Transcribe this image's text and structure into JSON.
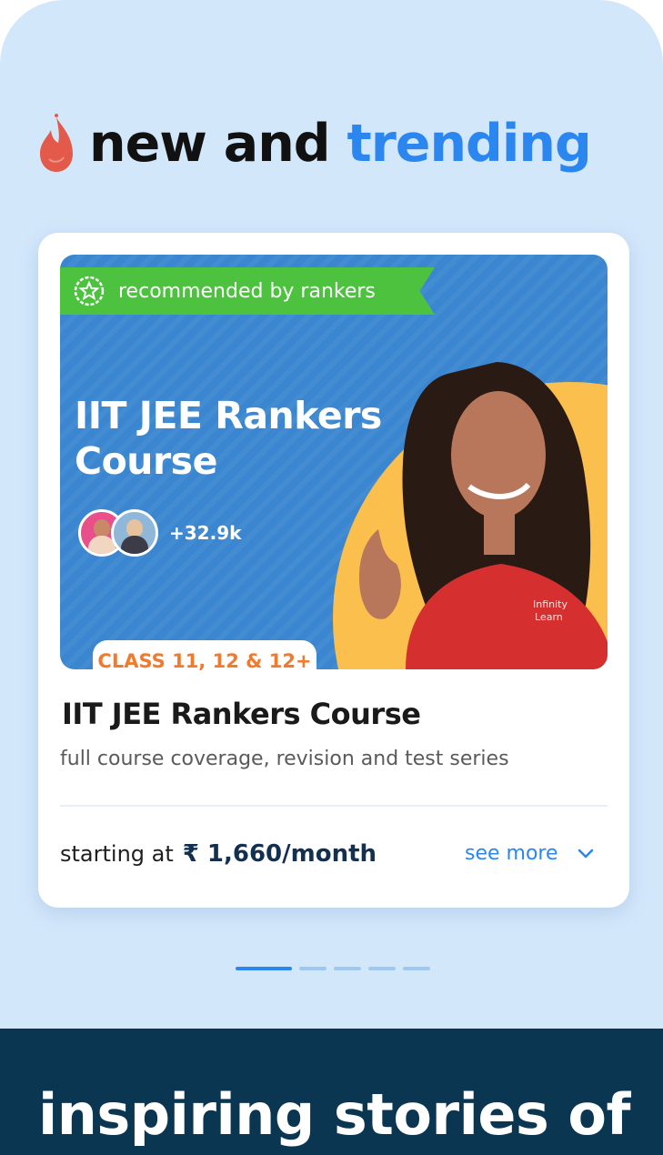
{
  "section": {
    "title_part1": "new and",
    "title_part2": "trending",
    "flame_icon": "flame-icon"
  },
  "course_card": {
    "ribbon_text": "recommended by rankers",
    "ribbon_icon": "star-badge-icon",
    "banner_title": "IIT JEE Rankers Course",
    "enrolled_count": "+32.9k",
    "class_tag": "CLASS 11, 12 & 12+",
    "title": "IIT JEE Rankers Course",
    "subtitle": "full course coverage, revision and test series",
    "price_prefix": "starting at",
    "price_value": "₹ 1,660/month",
    "see_more": "see more"
  },
  "carousel": {
    "total_pages": 5,
    "active_page": 1
  },
  "next_section": {
    "title": "inspiring stories of"
  },
  "colors": {
    "background": "#d3e7fb",
    "accent_blue": "#2b86f0",
    "ribbon_green": "#4cc23f",
    "class_tag_orange": "#f07a2e",
    "banner_blue": "#3a86d0",
    "dark_footer": "#0a3652"
  }
}
